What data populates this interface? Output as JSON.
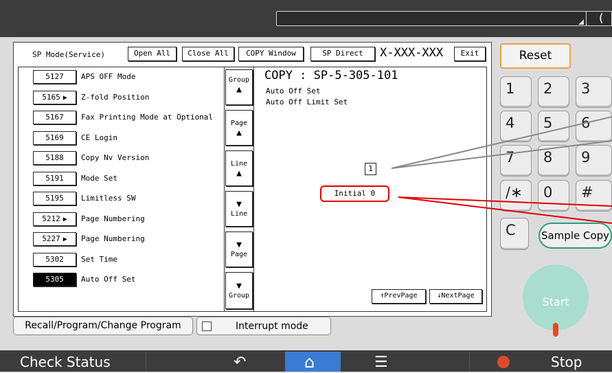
{
  "top": {
    "corner_glyph": "("
  },
  "header": {
    "mode_label": "SP Mode(Service)",
    "open_all": "Open All",
    "close_all": "Close All",
    "copy_window": "COPY Window",
    "sp_direct": "SP Direct",
    "sp_number": "X-XXX-XXX",
    "exit": "Exit"
  },
  "items": [
    {
      "num": "5127",
      "arrow": "",
      "label": "APS OFF Mode"
    },
    {
      "num": "5165",
      "arrow": "▶",
      "label": "Z-fold Position"
    },
    {
      "num": "5167",
      "arrow": "",
      "label": "Fax Printing Mode at Optional"
    },
    {
      "num": "5169",
      "arrow": "",
      "label": "CE Login"
    },
    {
      "num": "5188",
      "arrow": "",
      "label": "Copy Nv Version"
    },
    {
      "num": "5191",
      "arrow": "",
      "label": "Mode Set"
    },
    {
      "num": "5195",
      "arrow": "",
      "label": "Limitless SW"
    },
    {
      "num": "5212",
      "arrow": "▶",
      "label": "Page Numbering"
    },
    {
      "num": "5227",
      "arrow": "▶",
      "label": "Page Numbering"
    },
    {
      "num": "5302",
      "arrow": "",
      "label": "Set Time"
    },
    {
      "num": "5305",
      "arrow": "",
      "label": "Auto Off Set"
    }
  ],
  "nav": {
    "group_up": "Group",
    "page_up": "Page",
    "line_up": "Line",
    "line_down": "Line",
    "page_down": "Page",
    "group_down": "Group",
    "up_arrow": "▲",
    "down_arrow": "▼"
  },
  "detail": {
    "title": "COPY : SP-5-305-101",
    "line1": "Auto Off Set",
    "line2": "Auto Off Limit Set",
    "value": "1",
    "initial": "Initial 0",
    "prev_page": "↑PrevPage",
    "next_page": "↓NextPage"
  },
  "bottom_buttons": {
    "recall": "Recall/Program/Change Program",
    "interrupt": "Interrupt mode"
  },
  "keypad": {
    "reset": "Reset",
    "keys": [
      "1",
      "2",
      "3",
      "4",
      "5",
      "6",
      "7",
      "8",
      "9",
      "/∗",
      "0",
      "#"
    ],
    "clear": "C",
    "sample_copy": "Sample Copy",
    "start": "Start"
  },
  "bottombar": {
    "check_status": "Check Status",
    "back_glyph": "↶",
    "home_glyph": "⌂",
    "menu_glyph": "☰",
    "stop": "Stop"
  },
  "colors": {
    "reset_border": "#f0a040",
    "start_fill": "#a8ddd0",
    "sample_border": "#2a9d7a",
    "home_bg": "#3a7bd5",
    "stop_icon": "#e0482a",
    "annotation_red": "#e00000",
    "annotation_gray": "#888888"
  }
}
